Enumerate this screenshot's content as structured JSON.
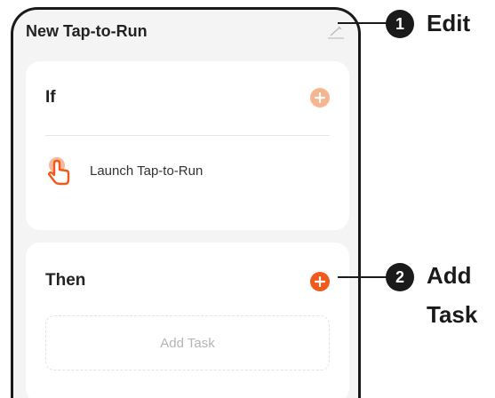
{
  "header": {
    "title": "New Tap-to-Run",
    "edit_icon": "pencil-icon"
  },
  "if_card": {
    "heading": "If",
    "add_icon": "plus-icon",
    "add_color": "#f6b48f",
    "condition": {
      "icon": "hand-tap-icon",
      "label": "Launch Tap-to-Run"
    }
  },
  "then_card": {
    "heading": "Then",
    "add_icon": "plus-icon",
    "add_color": "#f05a1a",
    "add_task_label": "Add Task"
  },
  "callouts": [
    {
      "number": "1",
      "label": "Edit"
    },
    {
      "number": "2",
      "label_line1": "Add",
      "label_line2": "Task"
    }
  ]
}
